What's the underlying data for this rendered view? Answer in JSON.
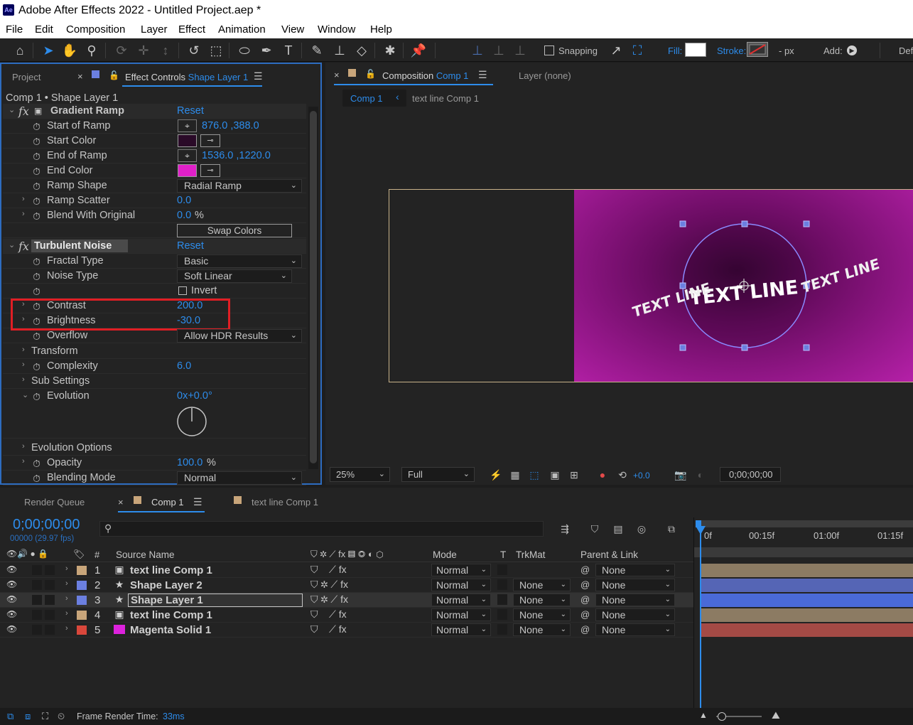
{
  "app": {
    "logo_text": "Ae",
    "window_title": "Adobe After Effects 2022 - Untitled Project.aep *"
  },
  "menu": [
    "File",
    "Edit",
    "Composition",
    "Layer",
    "Effect",
    "Animation",
    "View",
    "Window",
    "Help"
  ],
  "toolbar": {
    "snapping_label": "Snapping",
    "fill_label": "Fill:",
    "stroke_label": "Stroke:",
    "px_label": "- px",
    "add_label": "Add:",
    "workspace_cut": "Def"
  },
  "left_panel": {
    "tab_project": "Project",
    "tab_effect_controls_prefix": "Effect Controls",
    "tab_effect_controls_layer": "Shape Layer 1",
    "breadcrumb": "Comp 1 • Shape Layer 1",
    "reset": "Reset",
    "gradient_ramp": {
      "name": "Gradient Ramp",
      "start_of_ramp_label": "Start of Ramp",
      "start_of_ramp_value": "876.0 ,388.0",
      "start_color_label": "Start Color",
      "start_color": "#2a0a28",
      "end_of_ramp_label": "End of Ramp",
      "end_of_ramp_value": "1536.0 ,1220.0",
      "end_color_label": "End Color",
      "end_color": "#e020c8",
      "ramp_shape_label": "Ramp Shape",
      "ramp_shape_value": "Radial Ramp",
      "ramp_scatter_label": "Ramp Scatter",
      "ramp_scatter_value": "0.0",
      "blend_label": "Blend With Original",
      "blend_value": "0.0",
      "blend_unit": "%",
      "swap_colors": "Swap Colors"
    },
    "turbulent_noise": {
      "name": "Turbulent Noise",
      "fractal_type_label": "Fractal Type",
      "fractal_type_value": "Basic",
      "noise_type_label": "Noise Type",
      "noise_type_value": "Soft Linear",
      "invert_label": "Invert",
      "contrast_label": "Contrast",
      "contrast_value": "200.0",
      "brightness_label": "Brightness",
      "brightness_value": "-30.0",
      "overflow_label": "Overflow",
      "overflow_value": "Allow HDR Results",
      "transform_label": "Transform",
      "complexity_label": "Complexity",
      "complexity_value": "6.0",
      "sub_settings_label": "Sub Settings",
      "evolution_label": "Evolution",
      "evolution_value": "0x+0.0°",
      "evolution_options_label": "Evolution Options",
      "opacity_label": "Opacity",
      "opacity_value": "100.0",
      "opacity_unit": "%",
      "blending_mode_label": "Blending Mode",
      "blending_mode_value": "Normal"
    }
  },
  "comp_panel": {
    "tab_composition_prefix": "Composition",
    "tab_composition_name": "Comp 1",
    "tab_layer": "Layer (none)",
    "flow_comp1": "Comp 1",
    "flow_text_line": "text line Comp 1",
    "canvas_text_main": "TEXT LINE",
    "canvas_text_left": "TEXT LINE",
    "canvas_text_right": "TEXT LINE",
    "zoom": "25%",
    "resolution": "Full",
    "exposure": "+0.0",
    "timecode": "0;00;00;00",
    "bg_dark": "#3a0636",
    "bg_light": "#b520a8"
  },
  "timeline": {
    "tab_render_queue": "Render Queue",
    "tab_comp1": "Comp 1",
    "tab_text_line": "text line Comp 1",
    "current_time": "0;00;00;00",
    "frame_info": "00000 (29.97 fps)",
    "headers": {
      "num": "#",
      "source_name": "Source Name",
      "mode": "Mode",
      "t": "T",
      "trkmat": "TrkMat",
      "parent": "Parent & Link"
    },
    "ruler": [
      "0f",
      "00:15f",
      "01:00f",
      "01:15f"
    ],
    "layers": [
      {
        "num": "1",
        "name": "text line Comp 1",
        "label_color": "#c8a57a",
        "mode": "Normal",
        "trkmat": "",
        "parent": "None",
        "bar_color": "#8c7b63"
      },
      {
        "num": "2",
        "name": "Shape Layer 2",
        "label_color": "#6b7fe0",
        "mode": "Normal",
        "trkmat": "None",
        "parent": "None",
        "bar_color": "#5565b5"
      },
      {
        "num": "3",
        "name": "Shape Layer 1",
        "label_color": "#6b7fe0",
        "mode": "Normal",
        "trkmat": "None",
        "parent": "None",
        "bar_color": "#4a6ad8"
      },
      {
        "num": "4",
        "name": "text line Comp 1",
        "label_color": "#c8a57a",
        "mode": "Normal",
        "trkmat": "None",
        "parent": "None",
        "bar_color": "#8c7b63"
      },
      {
        "num": "5",
        "name": "Magenta Solid 1",
        "label_color": "#d9473b",
        "mode": "Normal",
        "trkmat": "None",
        "parent": "None",
        "bar_color": "#a44a45"
      }
    ]
  },
  "status": {
    "frame_render_label": "Frame Render Time:",
    "frame_render_value": "33ms"
  }
}
